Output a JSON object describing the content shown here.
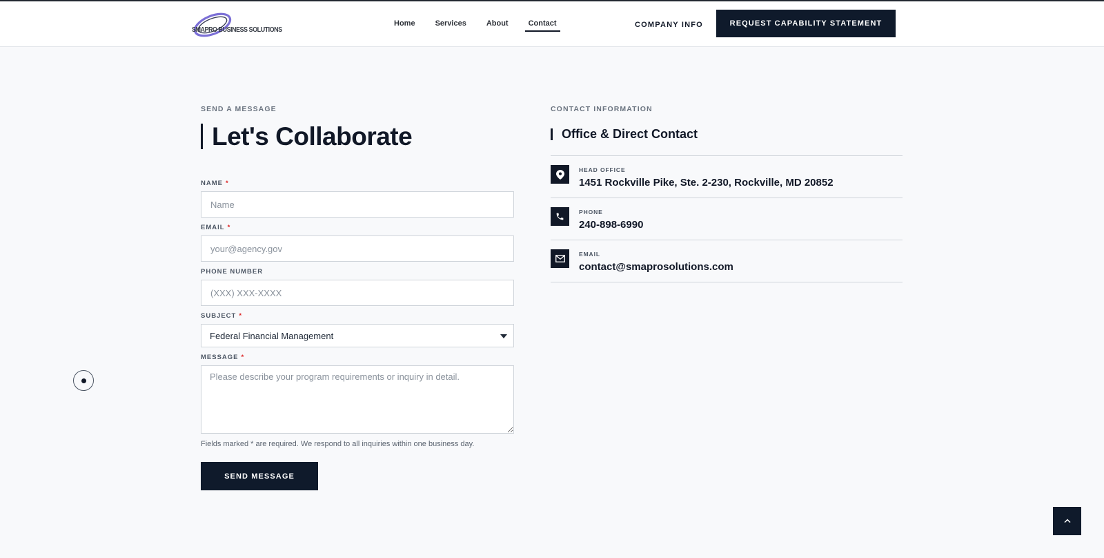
{
  "header": {
    "logo_text": "SMAPRO BUSINESS SOLUTIONS",
    "nav": [
      {
        "label": "Home",
        "active": false
      },
      {
        "label": "Services",
        "active": false
      },
      {
        "label": "About",
        "active": false
      },
      {
        "label": "Contact",
        "active": true
      }
    ],
    "company_info": "COMPANY INFO",
    "cta": "REQUEST CAPABILITY STATEMENT"
  },
  "form": {
    "eyebrow": "SEND A MESSAGE",
    "title": "Let's Collaborate",
    "name": {
      "label": "NAME",
      "required_mark": "*",
      "placeholder": "Name"
    },
    "email": {
      "label": "EMAIL",
      "required_mark": "*",
      "placeholder": "your@agency.gov"
    },
    "phone": {
      "label": "PHONE NUMBER",
      "placeholder": "(XXX) XXX-XXXX"
    },
    "subject": {
      "label": "SUBJECT",
      "required_mark": "*",
      "selected": "Federal Financial Management"
    },
    "message": {
      "label": "MESSAGE",
      "required_mark": "*",
      "placeholder": "Please describe your program requirements or inquiry in detail."
    },
    "note": "Fields marked * are required. We respond to all inquiries within one business day.",
    "submit": "SEND MESSAGE"
  },
  "contact": {
    "eyebrow": "CONTACT INFORMATION",
    "title": "Office & Direct Contact",
    "items": [
      {
        "icon": "map-pin-icon",
        "label": "HEAD OFFICE",
        "value": "1451 Rockville Pike, Ste. 2-230, Rockville, MD 20852"
      },
      {
        "icon": "phone-icon",
        "label": "PHONE",
        "value": "240-898-6990"
      },
      {
        "icon": "mail-icon",
        "label": "EMAIL",
        "value": "contact@smaprosolutions.com"
      }
    ]
  },
  "colors": {
    "primary": "#0f1a2b",
    "background": "#f8f9fb",
    "required": "#dc2626",
    "logo_accent": "#7b6fd6"
  }
}
